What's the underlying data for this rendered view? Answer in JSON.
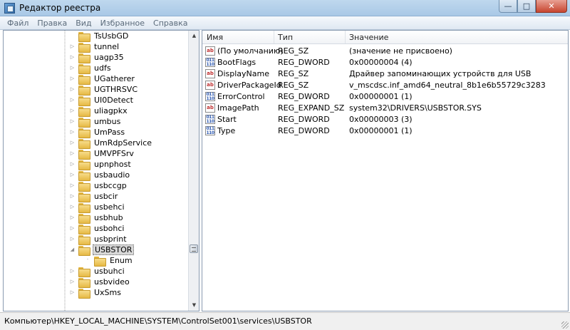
{
  "window": {
    "title": "Редактор реестра",
    "controls": {
      "minimize": "—",
      "maximize": "□",
      "close": "✕"
    }
  },
  "menu": [
    "Файл",
    "Правка",
    "Вид",
    "Избранное",
    "Справка"
  ],
  "tree": {
    "items": [
      {
        "label": "TsUsbGD",
        "expander": "",
        "indent": 0
      },
      {
        "label": "tunnel",
        "expander": "▷",
        "indent": 0
      },
      {
        "label": "uagp35",
        "expander": "▷",
        "indent": 0
      },
      {
        "label": "udfs",
        "expander": "▷",
        "indent": 0
      },
      {
        "label": "UGatherer",
        "expander": "▷",
        "indent": 0
      },
      {
        "label": "UGTHRSVC",
        "expander": "▷",
        "indent": 0
      },
      {
        "label": "UI0Detect",
        "expander": "▷",
        "indent": 0
      },
      {
        "label": "uliagpkx",
        "expander": "▷",
        "indent": 0
      },
      {
        "label": "umbus",
        "expander": "▷",
        "indent": 0
      },
      {
        "label": "UmPass",
        "expander": "▷",
        "indent": 0
      },
      {
        "label": "UmRdpService",
        "expander": "▷",
        "indent": 0
      },
      {
        "label": "UMVPFSrv",
        "expander": "▷",
        "indent": 0
      },
      {
        "label": "upnphost",
        "expander": "▷",
        "indent": 0
      },
      {
        "label": "usbaudio",
        "expander": "▷",
        "indent": 0
      },
      {
        "label": "usbccgp",
        "expander": "▷",
        "indent": 0
      },
      {
        "label": "usbcir",
        "expander": "▷",
        "indent": 0
      },
      {
        "label": "usbehci",
        "expander": "▷",
        "indent": 0
      },
      {
        "label": "usbhub",
        "expander": "▷",
        "indent": 0
      },
      {
        "label": "usbohci",
        "expander": "▷",
        "indent": 0
      },
      {
        "label": "usbprint",
        "expander": "▷",
        "indent": 0
      },
      {
        "label": "USBSTOR",
        "expander": "◢",
        "indent": 0,
        "selected": true
      },
      {
        "label": "Enum",
        "expander": "",
        "indent": 1
      },
      {
        "label": "usbuhci",
        "expander": "▷",
        "indent": 0
      },
      {
        "label": "usbvideo",
        "expander": "▷",
        "indent": 0
      },
      {
        "label": "UxSms",
        "expander": "▷",
        "indent": 0
      }
    ],
    "scroll": {
      "up": "▲",
      "down": "▼"
    }
  },
  "list": {
    "columns": {
      "name": "Имя",
      "type": "Тип",
      "value": "Значение"
    },
    "rows": [
      {
        "icon": "sz",
        "icon_text": "ab",
        "name": "(По умолчанию)",
        "type": "REG_SZ",
        "value": "(значение не присвоено)"
      },
      {
        "icon": "dw",
        "icon_text": "011 110",
        "name": "BootFlags",
        "type": "REG_DWORD",
        "value": "0x00000004 (4)"
      },
      {
        "icon": "sz",
        "icon_text": "ab",
        "name": "DisplayName",
        "type": "REG_SZ",
        "value": "Драйвер запоминающих устройств для USB"
      },
      {
        "icon": "sz",
        "icon_text": "ab",
        "name": "DriverPackageId",
        "type": "REG_SZ",
        "value": "v_mscdsc.inf_amd64_neutral_8b1e6b55729c3283"
      },
      {
        "icon": "dw",
        "icon_text": "011 110",
        "name": "ErrorControl",
        "type": "REG_DWORD",
        "value": "0x00000001 (1)"
      },
      {
        "icon": "sz",
        "icon_text": "ab",
        "name": "ImagePath",
        "type": "REG_EXPAND_SZ",
        "value": "system32\\DRIVERS\\USBSTOR.SYS"
      },
      {
        "icon": "dw",
        "icon_text": "011 110",
        "name": "Start",
        "type": "REG_DWORD",
        "value": "0x00000003 (3)"
      },
      {
        "icon": "dw",
        "icon_text": "011 110",
        "name": "Type",
        "type": "REG_DWORD",
        "value": "0x00000001 (1)"
      }
    ]
  },
  "status": {
    "path": "Компьютер\\HKEY_LOCAL_MACHINE\\SYSTEM\\ControlSet001\\services\\USBSTOR"
  }
}
